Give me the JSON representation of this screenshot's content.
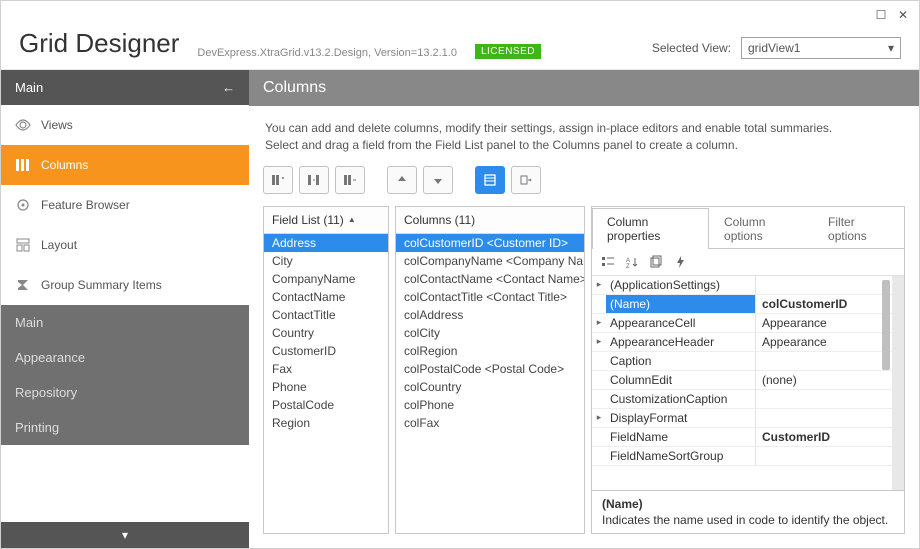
{
  "window": {
    "title": "Grid Designer",
    "version": "DevExpress.XtraGrid.v13.2.Design, Version=13.2.1.0",
    "license": "LICENSED"
  },
  "selectedView": {
    "label": "Selected View:",
    "value": "gridView1"
  },
  "sidebar": {
    "header": "Main",
    "items": [
      {
        "label": "Views"
      },
      {
        "label": "Columns"
      },
      {
        "label": "Feature Browser"
      },
      {
        "label": "Layout"
      },
      {
        "label": "Group Summary Items"
      }
    ],
    "groups": [
      {
        "label": "Main"
      },
      {
        "label": "Appearance"
      },
      {
        "label": "Repository"
      },
      {
        "label": "Printing"
      }
    ]
  },
  "main": {
    "title": "Columns",
    "desc1": "You can add and delete columns, modify their settings, assign in-place editors and enable total summaries.",
    "desc2": "Select and drag a field from the Field List panel to the Columns panel to create a column."
  },
  "fieldList": {
    "header": "Field List (11)",
    "items": [
      "Address",
      "City",
      "CompanyName",
      "ContactName",
      "ContactTitle",
      "Country",
      "CustomerID",
      "Fax",
      "Phone",
      "PostalCode",
      "Region"
    ]
  },
  "columnsPanel": {
    "header": "Columns (11)",
    "items": [
      "colCustomerID <Customer ID>",
      "colCompanyName <Company Name>",
      "colContactName <Contact Name>",
      "colContactTitle <Contact Title>",
      "colAddress",
      "colCity",
      "colRegion",
      "colPostalCode <Postal Code>",
      "colCountry",
      "colPhone",
      "colFax"
    ]
  },
  "propTabs": {
    "t0": "Column properties",
    "t1": "Column options",
    "t2": "Filter options"
  },
  "props": {
    "rows": [
      {
        "exp": "▸",
        "key": "(ApplicationSettings)",
        "val": ""
      },
      {
        "exp": "",
        "key": "(Name)",
        "val": "colCustomerID",
        "sel": true,
        "bold": true
      },
      {
        "exp": "▸",
        "key": "AppearanceCell",
        "val": "Appearance"
      },
      {
        "exp": "▸",
        "key": "AppearanceHeader",
        "val": "Appearance"
      },
      {
        "exp": "",
        "key": "Caption",
        "val": ""
      },
      {
        "exp": "",
        "key": "ColumnEdit",
        "val": "(none)"
      },
      {
        "exp": "",
        "key": "CustomizationCaption",
        "val": ""
      },
      {
        "exp": "▸",
        "key": "DisplayFormat",
        "val": ""
      },
      {
        "exp": "",
        "key": "FieldName",
        "val": "CustomerID",
        "bold": true
      },
      {
        "exp": "",
        "key": "FieldNameSortGroup",
        "val": ""
      }
    ],
    "descTitle": "(Name)",
    "descText": "Indicates the name used in code to identify the object."
  }
}
